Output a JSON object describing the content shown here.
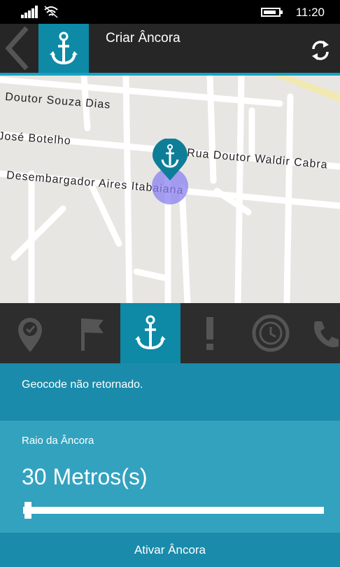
{
  "status": {
    "time": "11:20",
    "battery_level": 0.85
  },
  "header": {
    "title": "Criar Âncora",
    "icon": "anchor-icon",
    "back_icon": "chevron-left-icon",
    "refresh_icon": "refresh-icon"
  },
  "map": {
    "streets": [
      "Doutor Souza Dias",
      "José Botelho",
      "Rua Doutor Waldir Cabra",
      "Desembargador Aires Itabaiana"
    ],
    "marker_icon": "anchor-pin-icon"
  },
  "tabs": [
    {
      "icon": "location-check-icon",
      "active": false
    },
    {
      "icon": "flag-icon",
      "active": false
    },
    {
      "icon": "anchor-icon",
      "active": true
    },
    {
      "icon": "exclamation-icon",
      "active": false
    },
    {
      "icon": "history-icon",
      "active": false
    },
    {
      "icon": "phone-icon",
      "active": false
    }
  ],
  "info": {
    "message": "Geocode não retornado."
  },
  "radius": {
    "label": "Raio da Âncora",
    "value_text": "30 Metros(s)",
    "slider_fraction": 0.01
  },
  "action": {
    "label": "Ativar Âncora"
  },
  "colors": {
    "accent": "#0e8aa6",
    "info_bg": "#1a8bab",
    "radius_bg": "#33a2bf"
  }
}
